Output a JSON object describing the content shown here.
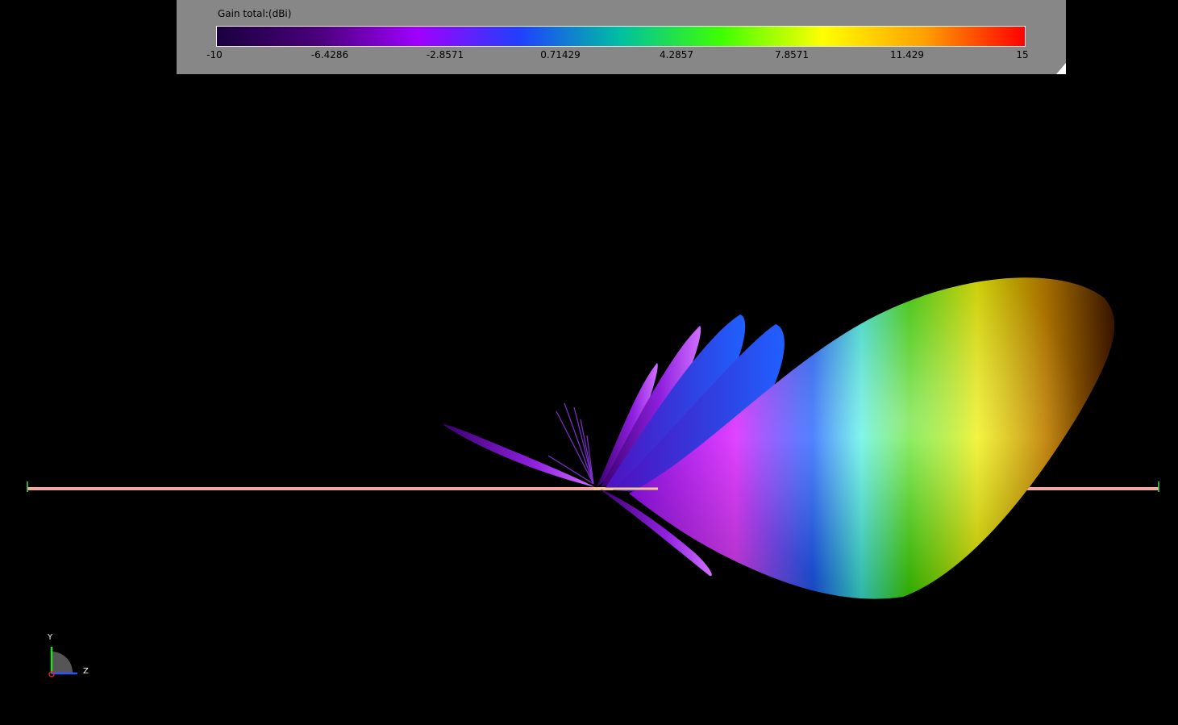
{
  "legend": {
    "title": "Gain total:(dBi)",
    "ticks": [
      "-10",
      "-6.4286",
      "-2.8571",
      "0.71429",
      "4.2857",
      "7.8571",
      "11.429",
      "15"
    ],
    "colors": [
      "#1a0040",
      "#4a007a",
      "#a000ff",
      "#2040ff",
      "#00c0a0",
      "#40ff00",
      "#ffff00",
      "#ffa000",
      "#ff0000"
    ]
  },
  "axes": {
    "y_label": "Y",
    "z_label": "Z"
  }
}
